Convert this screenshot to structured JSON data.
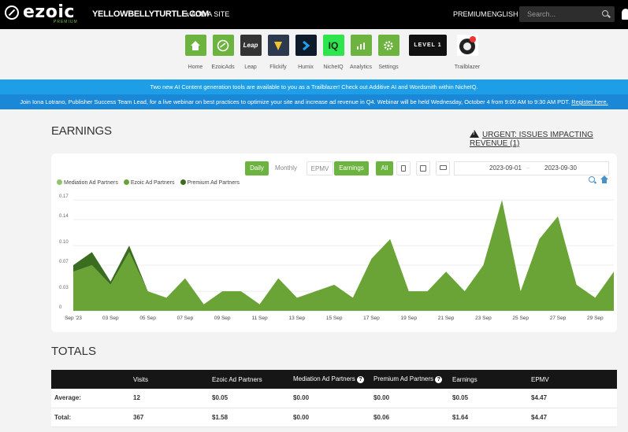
{
  "topnav": {
    "logo_text": "ezoic",
    "logo_sub": "PREMIUM",
    "site_name": "YELLOWBELLYTURTLE.COM",
    "add_site": "+ ADD A SITE",
    "premium": "PREMIUM",
    "language": "ENGLISH ▾",
    "search_placeholder": "Search..."
  },
  "apps": [
    {
      "label": "Home",
      "icon": "home-icon",
      "color": "#6db33f"
    },
    {
      "label": "EzoicAds",
      "icon": "ezoicads-icon",
      "color": "#6db33f"
    },
    {
      "label": "Leap",
      "icon": "leap-icon",
      "color": "#333333",
      "tile_text": "Leap"
    },
    {
      "label": "Flickify",
      "icon": "flickify-icon",
      "color": "#2b3a4e"
    },
    {
      "label": "Humix",
      "icon": "humix-icon",
      "color": "#0d1b2a"
    },
    {
      "label": "NicheIQ",
      "icon": "nicheiq-icon",
      "color": "#2ee54d",
      "tile_text": "IQ"
    },
    {
      "label": "Analytics",
      "icon": "analytics-icon",
      "color": "#6db33f"
    },
    {
      "label": "Settings",
      "icon": "settings-icon",
      "color": "#6db33f"
    },
    {
      "label": "",
      "icon": "level-badge-icon",
      "color": "#111111",
      "tile_text": "LEVEL 1"
    },
    {
      "label": "Trailblazer",
      "icon": "trailblazer-icon",
      "color": "#ffffff"
    }
  ],
  "banners": {
    "ai": "Two new AI Content generation tools are available to you as a Trailblazer! Check out Additive AI and Wordsmith within NicheIQ.",
    "webinar": "Join Iona Lotrano, Publisher Success Team Lead, for a live webinar on best practices to optimize your site and increase ad revenue in Q4. Webinar will be held Wednesday, October 4 from 9:00 AM to 9:30 AM PDT.",
    "register": "Register here."
  },
  "earnings": {
    "title": "EARNINGS",
    "urgent": "URGENT: ISSUES IMPACTING REVENUE (1)",
    "controls": {
      "daily": "Daily",
      "monthly": "Monthly",
      "epmv": "EPMV",
      "earnings": "Earnings",
      "all": "All"
    },
    "date_from": "2023-09-01",
    "date_sep": "–",
    "date_to": "2023-09-30"
  },
  "chart_data": {
    "type": "area",
    "x": [
      "Sep '23",
      "02 Sep",
      "03 Sep",
      "04 Sep",
      "05 Sep",
      "06 Sep",
      "07 Sep",
      "08 Sep",
      "09 Sep",
      "10 Sep",
      "11 Sep",
      "12 Sep",
      "13 Sep",
      "14 Sep",
      "15 Sep",
      "16 Sep",
      "17 Sep",
      "18 Sep",
      "19 Sep",
      "20 Sep",
      "21 Sep",
      "22 Sep",
      "23 Sep",
      "24 Sep",
      "25 Sep",
      "26 Sep",
      "27 Sep",
      "28 Sep",
      "29 Sep",
      "30 Sep"
    ],
    "xticks": [
      "Sep '23",
      "03 Sep",
      "05 Sep",
      "07 Sep",
      "09 Sep",
      "11 Sep",
      "13 Sep",
      "15 Sep",
      "17 Sep",
      "19 Sep",
      "21 Sep",
      "23 Sep",
      "25 Sep",
      "27 Sep",
      "29 Sep"
    ],
    "yticks": [
      "0",
      "0.03",
      "0.07",
      "0.10",
      "0.14",
      "0.17"
    ],
    "ylim": [
      0,
      0.175
    ],
    "series": [
      {
        "name": "Mediation Ad Partners",
        "color": "#8fc56a",
        "values": [
          0,
          0,
          0,
          0,
          0,
          0,
          0,
          0,
          0,
          0,
          0,
          0,
          0,
          0,
          0,
          0,
          0,
          0,
          0,
          0,
          0,
          0,
          0,
          0,
          0,
          0,
          0,
          0,
          0,
          0
        ]
      },
      {
        "name": "Ezoic Ad Partners",
        "color": "#6aa437",
        "values": [
          0.06,
          0.07,
          0.04,
          0.09,
          0.03,
          0.02,
          0.05,
          0.01,
          0.03,
          0.03,
          0.01,
          0.05,
          0.02,
          0.03,
          0.04,
          0.02,
          0.08,
          0.11,
          0.03,
          0.03,
          0.06,
          0.03,
          0.07,
          0.17,
          0.03,
          0.11,
          0.145,
          0.04,
          0.02,
          0.06
        ]
      },
      {
        "name": "Premium Ad Partners",
        "color": "#3b6d21",
        "values": [
          0.01,
          0.02,
          0.005,
          0.01,
          0,
          0,
          0,
          0,
          0,
          0,
          0,
          0,
          0,
          0,
          0,
          0,
          0,
          0,
          0,
          0,
          0,
          0,
          0,
          0,
          0,
          0,
          0,
          0,
          0,
          0
        ]
      }
    ]
  },
  "totals": {
    "title": "TOTALS",
    "headers": [
      "",
      "Visits",
      "Ezoic Ad Partners",
      "Mediation Ad Partners",
      "Premium Ad Partners",
      "Earnings",
      "EPMV"
    ],
    "rows": [
      [
        "Average:",
        "12",
        "$0.05",
        "$0.00",
        "$0.00",
        "$0.05",
        "$4.47"
      ],
      [
        "Total:",
        "367",
        "$1.58",
        "$0.00",
        "$0.06",
        "$1.64",
        "$4.47"
      ]
    ]
  }
}
